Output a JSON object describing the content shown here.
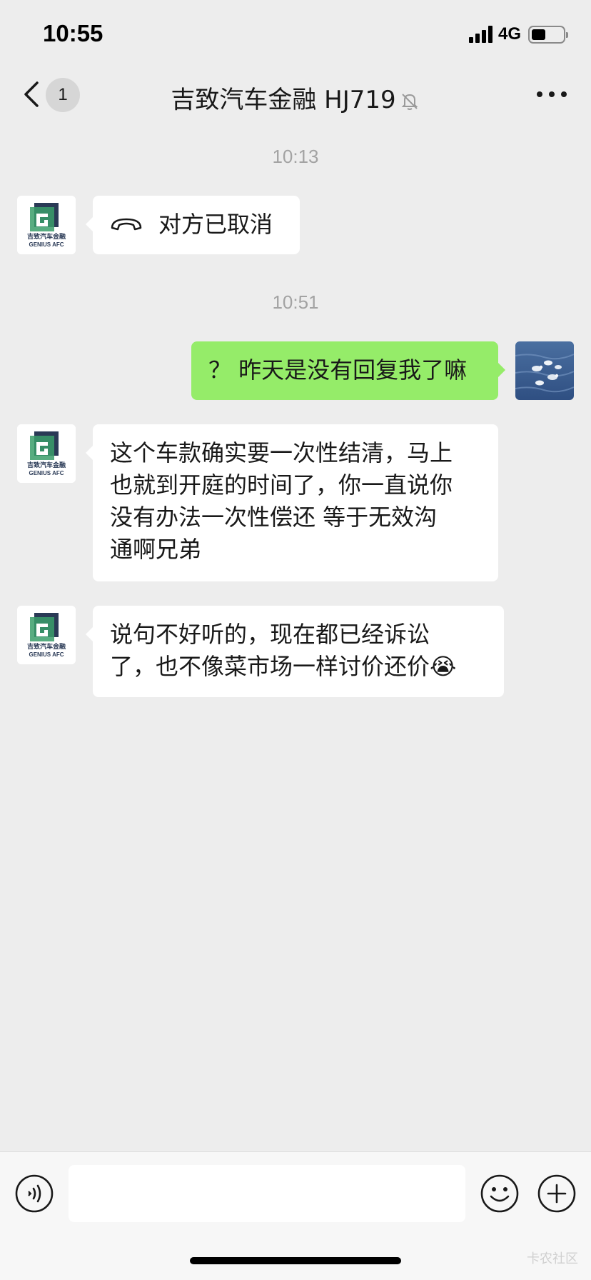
{
  "status_bar": {
    "time": "10:55",
    "network": "4G",
    "battery_level": 0.45
  },
  "nav": {
    "back_icon": "chevron-left-icon",
    "unread_count": "1",
    "title": "吉致汽车金融 HJ719",
    "mute_icon": "bell-off-icon",
    "more_icon": "more-icon"
  },
  "chat": {
    "timestamps": [
      "10:13",
      "10:51"
    ],
    "sender_avatar_text": {
      "cn": "吉致汽车金融",
      "en": "GENIUS AFC"
    },
    "messages": [
      {
        "side": "left",
        "type": "call",
        "icon": "phone-hangup-icon",
        "text": "对方已取消"
      },
      {
        "side": "right",
        "type": "text",
        "text": "？ 昨天是没有回复我了嘛"
      },
      {
        "side": "left",
        "type": "text",
        "lines": [
          "这个车款确实要一次性结清，马上",
          "也就到开庭的时间了，你一直说你",
          "没有办法一次性偿还 等于无效沟",
          "通啊兄弟"
        ]
      },
      {
        "side": "left",
        "type": "text",
        "lines": [
          "说句不好听的，现在都已经诉讼",
          "了，也不像菜市场一样讨价还价"
        ],
        "trailing_emoji": "😭"
      }
    ]
  },
  "input_bar": {
    "voice_icon": "voice-icon",
    "input_value": "",
    "emoji_icon": "emoji-icon",
    "plus_icon": "plus-icon"
  },
  "watermark": "卡农社区",
  "colors": {
    "background": "#ededed",
    "sent_bubble": "#95ec69",
    "received_bubble": "#ffffff",
    "timestamp": "#a3a3a3"
  }
}
